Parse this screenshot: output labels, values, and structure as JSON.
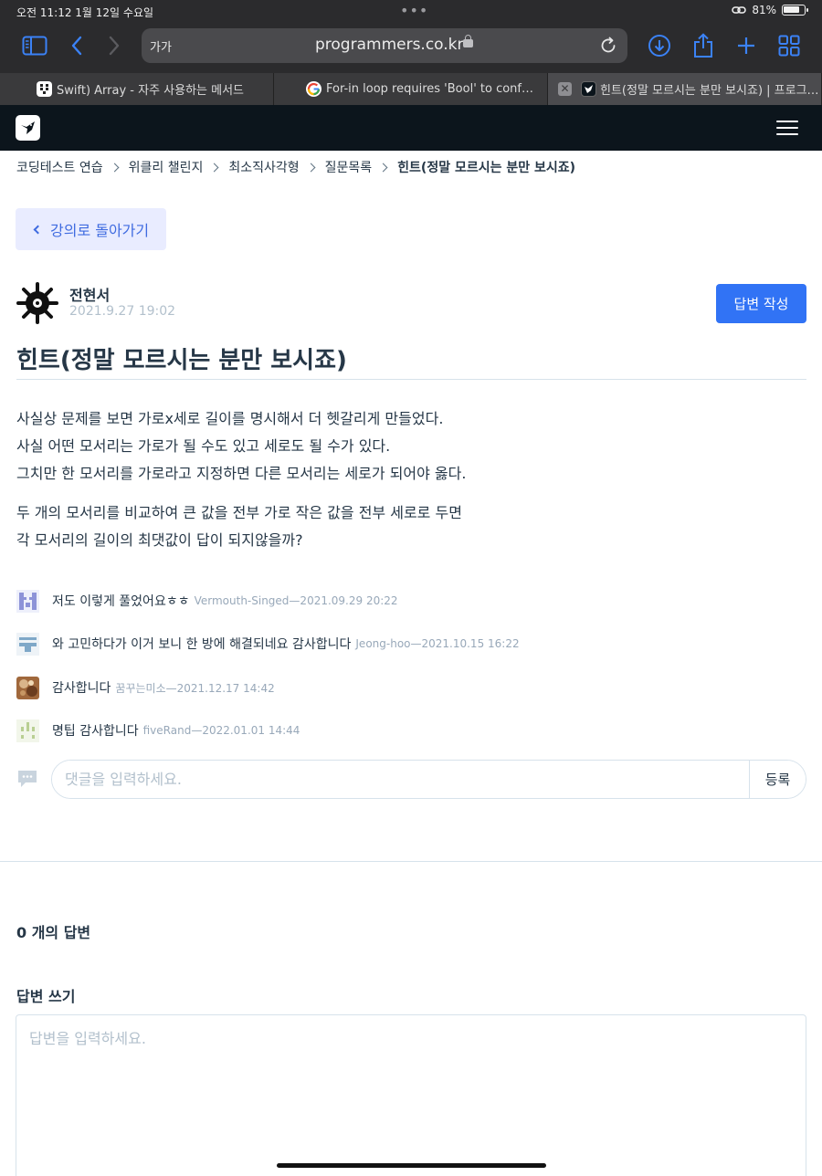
{
  "status_bar": {
    "time_date": "오전 11:12   1월 12일 수요일",
    "dots": "•••",
    "battery_percent": "81%",
    "battery_level": 0.81
  },
  "browser": {
    "text_size_label": "가가",
    "url": "programmers.co.kr",
    "tabs": [
      {
        "title": "Swift) Array - 자주 사용하는 메서드",
        "icon": "notion-icon"
      },
      {
        "title": "For-in loop requires 'Bool' to conf…",
        "icon": "google-icon"
      },
      {
        "title": "힌트(정말 모르시는 분만 보시죠) | 프로그…",
        "icon": "programmers-icon",
        "active": true
      }
    ],
    "close_tab_glyph": "✕"
  },
  "breadcrumb": {
    "items": [
      "코딩테스트 연습",
      "위클리 챌린지",
      "최소직사각형",
      "질문목록"
    ],
    "current": "힌트(정말 모르시는 분만 보시죠)"
  },
  "back_button": {
    "label": "강의로 돌아가기"
  },
  "post": {
    "author": "전현서",
    "date": "2021.9.27 19:02",
    "answer_button_label": "답변 작성",
    "title": "힌트(정말 모르시는 분만 보시죠)",
    "paragraphs": [
      "사실상 문제를 보면 가로x세로 길이를 명시해서 더 헷갈리게 만들었다.",
      "사실 어떤 모서리는 가로가 될 수도 있고 세로도 될 수가 있다.",
      "그치만 한 모서리를 가로라고 지정하면 다른 모서리는 세로가 되어야 옳다.",
      "두 개의 모서리를 비교하여 큰 값을 전부 가로 작은 값을 전부 세로로 두면",
      "각 모서리의 길이의 최댓값이 답이 되지않을까?"
    ]
  },
  "comments": [
    {
      "text": "저도 이렇게 풀었어요ㅎㅎ",
      "meta": "Vermouth-Singed—2021.09.29 20:22"
    },
    {
      "text": "와 고민하다가 이거 보니 한 방에 해결되네요 감사합니다",
      "meta": "Jeong-hoo—2021.10.15 16:22"
    },
    {
      "text": "감사합니다",
      "meta": "꿈꾸는미소—2021.12.17 14:42"
    },
    {
      "text": "명팁 감사합니다",
      "meta": "fiveRand—2022.01.01 14:44"
    }
  ],
  "comment_form": {
    "placeholder": "댓글을 입력하세요.",
    "submit_label": "등록"
  },
  "answers": {
    "count_label": "0 개의 답변",
    "write_heading": "답변 쓰기",
    "placeholder": "답변을 입력하세요."
  },
  "colors": {
    "primary": "#3173f5",
    "back_button_bg": "#e9ecff",
    "back_button_text": "#3f6be0",
    "header_bg": "#0c151c",
    "text": "#263747",
    "muted": "#b2c0cc"
  }
}
